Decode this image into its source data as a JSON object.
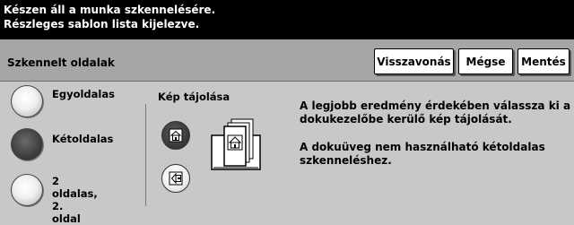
{
  "status": {
    "line1": "Készen áll a munka szkennelésére.",
    "line2": "Részleges sablon lista kijelezve."
  },
  "header": {
    "title": "Szkennelt oldalak",
    "buttons": {
      "undo": "Visszavonás",
      "cancel": "Mégse",
      "save": "Mentés"
    }
  },
  "sides_options": [
    {
      "label_line1": "Egyoldalas",
      "label_line2": "",
      "selected": false
    },
    {
      "label_line1": "Kétoldalas",
      "label_line2": "",
      "selected": true
    },
    {
      "label_line1": "2 oldalas, 2.",
      "label_line2": "oldal",
      "selected": false
    }
  ],
  "orientation": {
    "label": "Kép tájolása",
    "selected": "upright"
  },
  "help": {
    "line1": "A legjobb eredmény érdekében válassza ki a",
    "line2": "dokukezelőbe kerülő kép tájolását.",
    "line3": "A dokuüveg nem használható kétoldalas",
    "line4": "szkenneléshez."
  }
}
